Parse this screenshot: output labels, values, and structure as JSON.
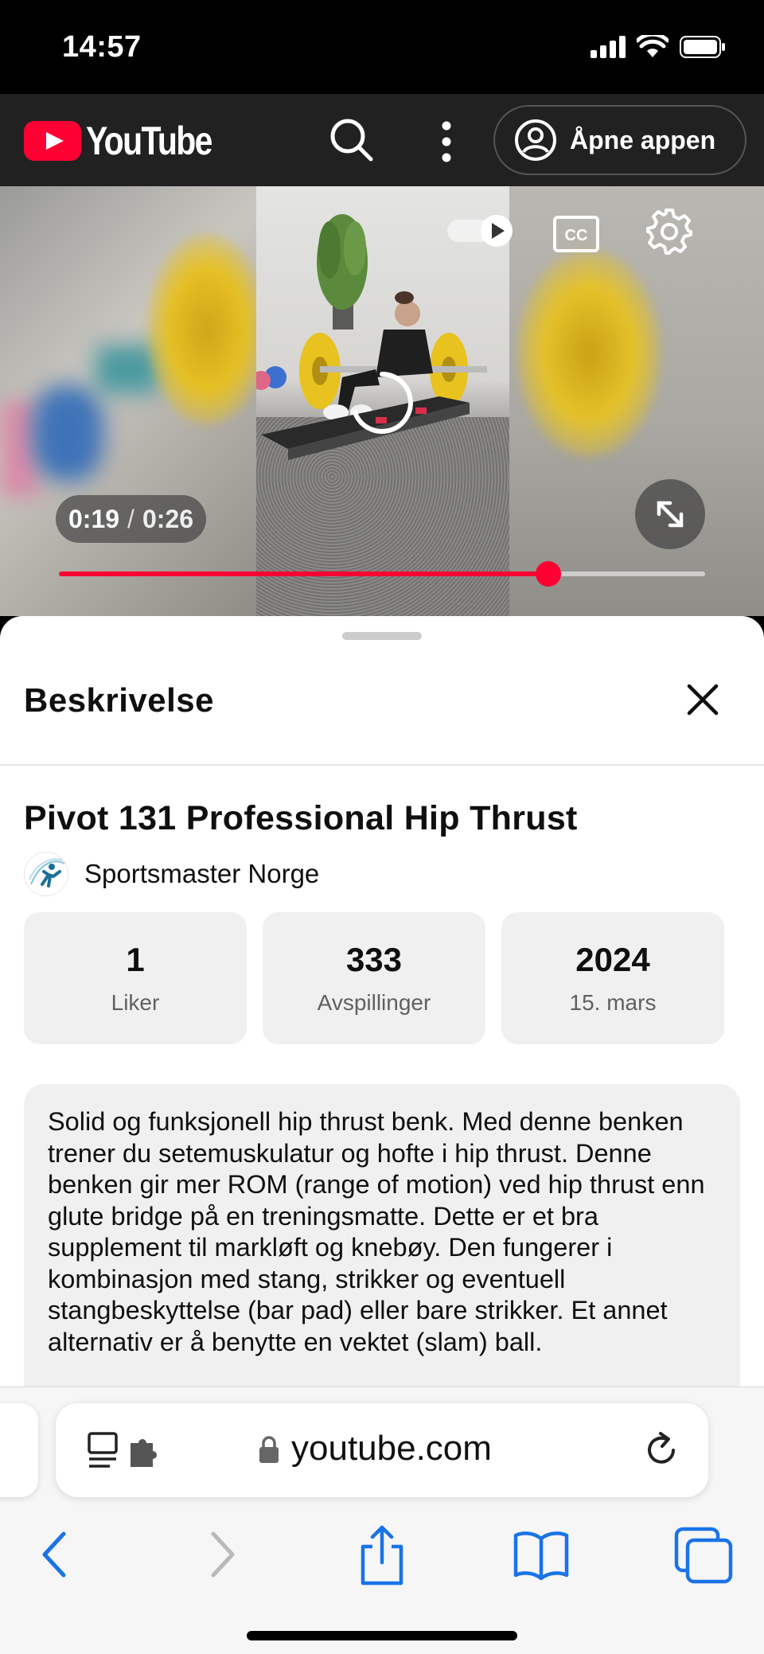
{
  "status": {
    "time": "14:57",
    "icons": [
      "signal-icon",
      "wifi-icon",
      "battery-icon"
    ]
  },
  "header": {
    "logo_text": "YouTube",
    "open_app_label": "Åpne appen",
    "icons": [
      "search-icon",
      "more-vert-icon",
      "account-circle-icon"
    ]
  },
  "player": {
    "current_time": "0:19",
    "separator": "/",
    "duration": "0:26",
    "progress": 0.757,
    "icons": [
      "autoplay-toggle-icon",
      "cc-icon",
      "settings-icon",
      "fullscreen-icon",
      "loading-icon"
    ]
  },
  "description": {
    "heading": "Beskrivelse",
    "title": "Pivot 131 Professional Hip Thrust",
    "channel": "Sportsmaster Norge",
    "stats": [
      {
        "value": "1",
        "label": "Liker"
      },
      {
        "value": "333",
        "label": "Avspillinger"
      },
      {
        "value": "2024",
        "label": "15. mars"
      }
    ],
    "body": "Solid og funksjonell hip thrust benk. Med denne benken trener du setemuskulatur og hofte i hip thrust. Denne benken gir mer ROM (range of motion) ved hip thrust enn glute bridge på en treningsmatte. Dette er et bra supplement til markløft og knebøy. Den fungerer i kombinasjon med stang, strikker og eventuell stangbeskyttelse (bar pad) eller bare strikker. Et annet alternativ er å benytte en vektet (slam) ball."
  },
  "browser": {
    "url": "youtube.com",
    "accent": "#1a73e8",
    "icons": [
      "reader-icon",
      "extension-icon",
      "lock-icon",
      "reload-icon",
      "back-icon",
      "forward-icon",
      "share-icon",
      "bookmarks-icon",
      "tabs-icon"
    ]
  }
}
